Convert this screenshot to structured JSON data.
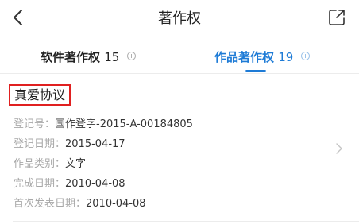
{
  "header": {
    "title": "著作权",
    "back_icon": "chevron-left-icon",
    "share_icon": "share-icon"
  },
  "tabs": [
    {
      "label": "软件著作权",
      "count": "15",
      "active": false
    },
    {
      "label": "作品著作权",
      "count": "19",
      "active": true
    }
  ],
  "colors": {
    "accent": "#1e7bd6",
    "highlight_border": "#e02020",
    "label_gray": "#a8a8a8"
  },
  "record": {
    "title": "真爱协议",
    "fields": [
      {
        "label": "登记号：",
        "value": "国作登字-2015-A-00184805"
      },
      {
        "label": "登记日期：",
        "value": "2015-04-17"
      },
      {
        "label": "作品类别：",
        "value": "文字"
      },
      {
        "label": "完成日期：",
        "value": "2010-04-08"
      },
      {
        "label": "首次发表日期：",
        "value": "2010-04-08"
      }
    ]
  }
}
